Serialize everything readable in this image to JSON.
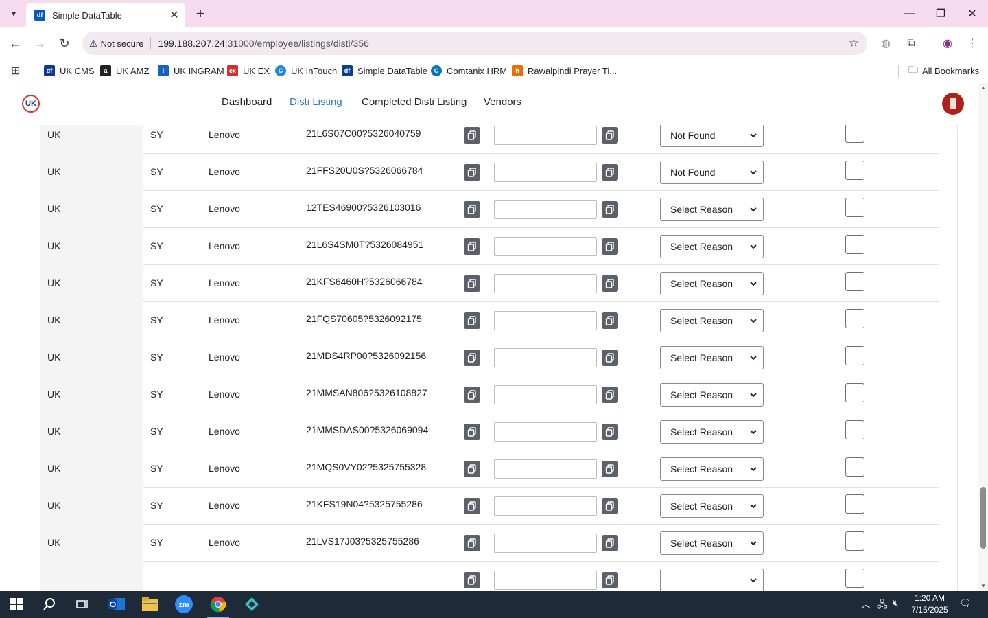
{
  "browser": {
    "tab_title": "Simple DataTable",
    "tab_favicon": "df",
    "url_warning": "Not secure",
    "url_host": "199.188.207.24",
    "url_path": ":31000/employee/listings/disti/356"
  },
  "bookmarks": [
    {
      "label": "UK CMS",
      "icon_color": "#0b3d91",
      "icon_text": "df"
    },
    {
      "label": "UK AMZ",
      "icon_color": "#222222",
      "icon_text": "a"
    },
    {
      "label": "UK INGRAM",
      "icon_color": "#1565c0",
      "icon_text": "I"
    },
    {
      "label": "UK EX",
      "icon_color": "#d32f2f",
      "icon_text": "ex"
    },
    {
      "label": "UK InTouch",
      "icon_color": "#1e88e5",
      "icon_text": "C"
    },
    {
      "label": "Simple DataTable",
      "icon_color": "#0b3d91",
      "icon_text": "df"
    },
    {
      "label": "Comtanix HRM",
      "icon_color": "#0277bd",
      "icon_text": "C"
    },
    {
      "label": "Rawalpindi Prayer Ti...",
      "icon_color": "#ef6c00",
      "icon_text": "h"
    }
  ],
  "all_bookmarks": "All Bookmarks",
  "nav": {
    "logo": "UK",
    "links": [
      "Dashboard",
      "Disti Listing",
      "Completed Disti Listing",
      "Vendors"
    ],
    "active": "Disti Listing"
  },
  "rows": [
    {
      "country": "UK",
      "code": "SY",
      "brand": "Lenovo",
      "sku": "21L6S07C00?5326040759",
      "reason": "Not Found"
    },
    {
      "country": "UK",
      "code": "SY",
      "brand": "Lenovo",
      "sku": "21FFS20U0S?5326066784",
      "reason": "Not Found"
    },
    {
      "country": "UK",
      "code": "SY",
      "brand": "Lenovo",
      "sku": "12TES46900?5326103016",
      "reason": "Select Reason"
    },
    {
      "country": "UK",
      "code": "SY",
      "brand": "Lenovo",
      "sku": "21L6S4SM0T?5326084951",
      "reason": "Select Reason"
    },
    {
      "country": "UK",
      "code": "SY",
      "brand": "Lenovo",
      "sku": "21KFS6460H?5326066784",
      "reason": "Select Reason"
    },
    {
      "country": "UK",
      "code": "SY",
      "brand": "Lenovo",
      "sku": "21FQS70605?5326092175",
      "reason": "Select Reason"
    },
    {
      "country": "UK",
      "code": "SY",
      "brand": "Lenovo",
      "sku": "21MDS4RP00?5326092156",
      "reason": "Select Reason"
    },
    {
      "country": "UK",
      "code": "SY",
      "brand": "Lenovo",
      "sku": "21MMSAN806?5326108827",
      "reason": "Select Reason"
    },
    {
      "country": "UK",
      "code": "SY",
      "brand": "Lenovo",
      "sku": "21MMSDAS00?5326069094",
      "reason": "Select Reason"
    },
    {
      "country": "UK",
      "code": "SY",
      "brand": "Lenovo",
      "sku": "21MQS0VY02?5325755328",
      "reason": "Select Reason"
    },
    {
      "country": "UK",
      "code": "SY",
      "brand": "Lenovo",
      "sku": "21KFS19N04?5325755286",
      "reason": "Select Reason"
    },
    {
      "country": "UK",
      "code": "SY",
      "brand": "Lenovo",
      "sku": "21LVS17J03?5325755286",
      "reason": "Select Reason"
    },
    {
      "country": "",
      "code": "",
      "brand": "",
      "sku": "",
      "reason": ""
    }
  ],
  "taskbar": {
    "time": "1:20 AM",
    "date": "7/15/2025"
  }
}
